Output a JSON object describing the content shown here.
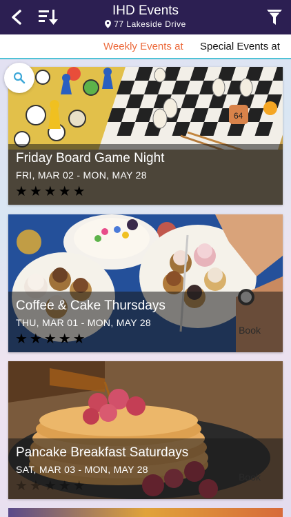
{
  "header": {
    "title": "IHD Events",
    "location": "77 Lakeside Drive",
    "icons": [
      "back-arrow-icon",
      "sort-down-icon",
      "location-pin-icon",
      "filter-funnel-icon"
    ]
  },
  "tabs": [
    {
      "label": "Weekly Events at",
      "active": true
    },
    {
      "label": "Special Events at",
      "active": false
    }
  ],
  "colors": {
    "header_bg": "#2c1f52",
    "active_tab": "#ec6a3b",
    "tab_underline": "#4fc2d6",
    "search_icon": "#3ea8d8"
  },
  "events": [
    {
      "title": "Friday Board Game Night",
      "dates": "FRI, MAR 02 - MON, MAY 28",
      "stars": "★★★★★",
      "book": ""
    },
    {
      "title": "Coffee & Cake Thursdays",
      "dates": "THU, MAR 01 - MON, MAY 28",
      "stars": "★★★★★",
      "book": "Book"
    },
    {
      "title": "Pancake Breakfast Saturdays",
      "dates": "SAT, MAR 03 - MON, MAY 28",
      "stars": "★★★★★",
      "book": "Book"
    }
  ]
}
